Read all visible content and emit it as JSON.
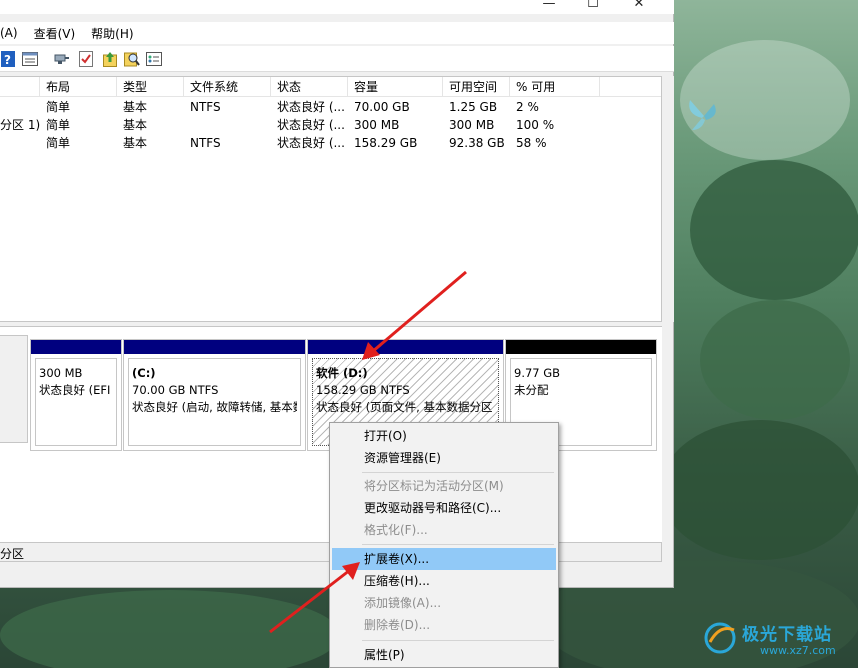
{
  "window": {
    "controls": {
      "minimize": "—",
      "maximize": "☐",
      "close": "✕"
    },
    "menu": [
      "(A)",
      "查看(V)",
      "帮助(H)"
    ]
  },
  "volume_list": {
    "headers": [
      "",
      "布局",
      "类型",
      "文件系统",
      "状态",
      "容量",
      "可用空间",
      "% 可用"
    ],
    "rows": [
      {
        "name": "",
        "layout": "简单",
        "type": "基本",
        "fs": "NTFS",
        "status": "状态良好 (...",
        "capacity": "70.00 GB",
        "free": "1.25 GB",
        "pct": "2 %"
      },
      {
        "name": "分区 1)",
        "layout": "简单",
        "type": "基本",
        "fs": "",
        "status": "状态良好 (...",
        "capacity": "300 MB",
        "free": "300 MB",
        "pct": "100 %"
      },
      {
        "name": "",
        "layout": "简单",
        "type": "基本",
        "fs": "NTFS",
        "status": "状态良好 (...",
        "capacity": "158.29 GB",
        "free": "92.38 GB",
        "pct": "58 %"
      }
    ]
  },
  "disk_map": {
    "partitions": [
      {
        "title": "",
        "size": "300 MB",
        "status": "状态良好 (EFI 系",
        "bar": "blue"
      },
      {
        "title": "(C:)",
        "size": "70.00 GB NTFS",
        "status": "状态良好 (启动, 故障转储, 基本数",
        "bar": "blue"
      },
      {
        "title": "软件  (D:)",
        "size": "158.29 GB NTFS",
        "status": "状态良好 (页面文件, 基本数据分区",
        "bar": "blue",
        "selected": true
      },
      {
        "title": "",
        "size": "9.77 GB",
        "status": "未分配",
        "bar": "black"
      }
    ]
  },
  "status_bar": {
    "text": "分区"
  },
  "context_menu": {
    "items": [
      {
        "label": "打开(O)",
        "enabled": true
      },
      {
        "label": "资源管理器(E)",
        "enabled": true
      },
      {
        "label": "将分区标记为活动分区(M)",
        "enabled": false
      },
      {
        "label": "更改驱动器号和路径(C)...",
        "enabled": true
      },
      {
        "label": "格式化(F)...",
        "enabled": false
      },
      {
        "label": "扩展卷(X)...",
        "enabled": true,
        "highlighted": true
      },
      {
        "label": "压缩卷(H)...",
        "enabled": true
      },
      {
        "label": "添加镜像(A)...",
        "enabled": false
      },
      {
        "label": "删除卷(D)...",
        "enabled": false
      },
      {
        "label": "属性(P)",
        "enabled": true
      }
    ]
  },
  "watermark": {
    "text": "极光下载站",
    "url": "www.xz7.com"
  },
  "colors": {
    "partition_bar": "#00007f",
    "unallocated_bar": "#000000",
    "menu_highlight": "#91c9f7",
    "arrow": "#e0201e"
  },
  "icons": [
    "help-icon",
    "properties-icon",
    "connect-icon",
    "check-icon",
    "up-icon",
    "search-icon",
    "settings-icon"
  ]
}
